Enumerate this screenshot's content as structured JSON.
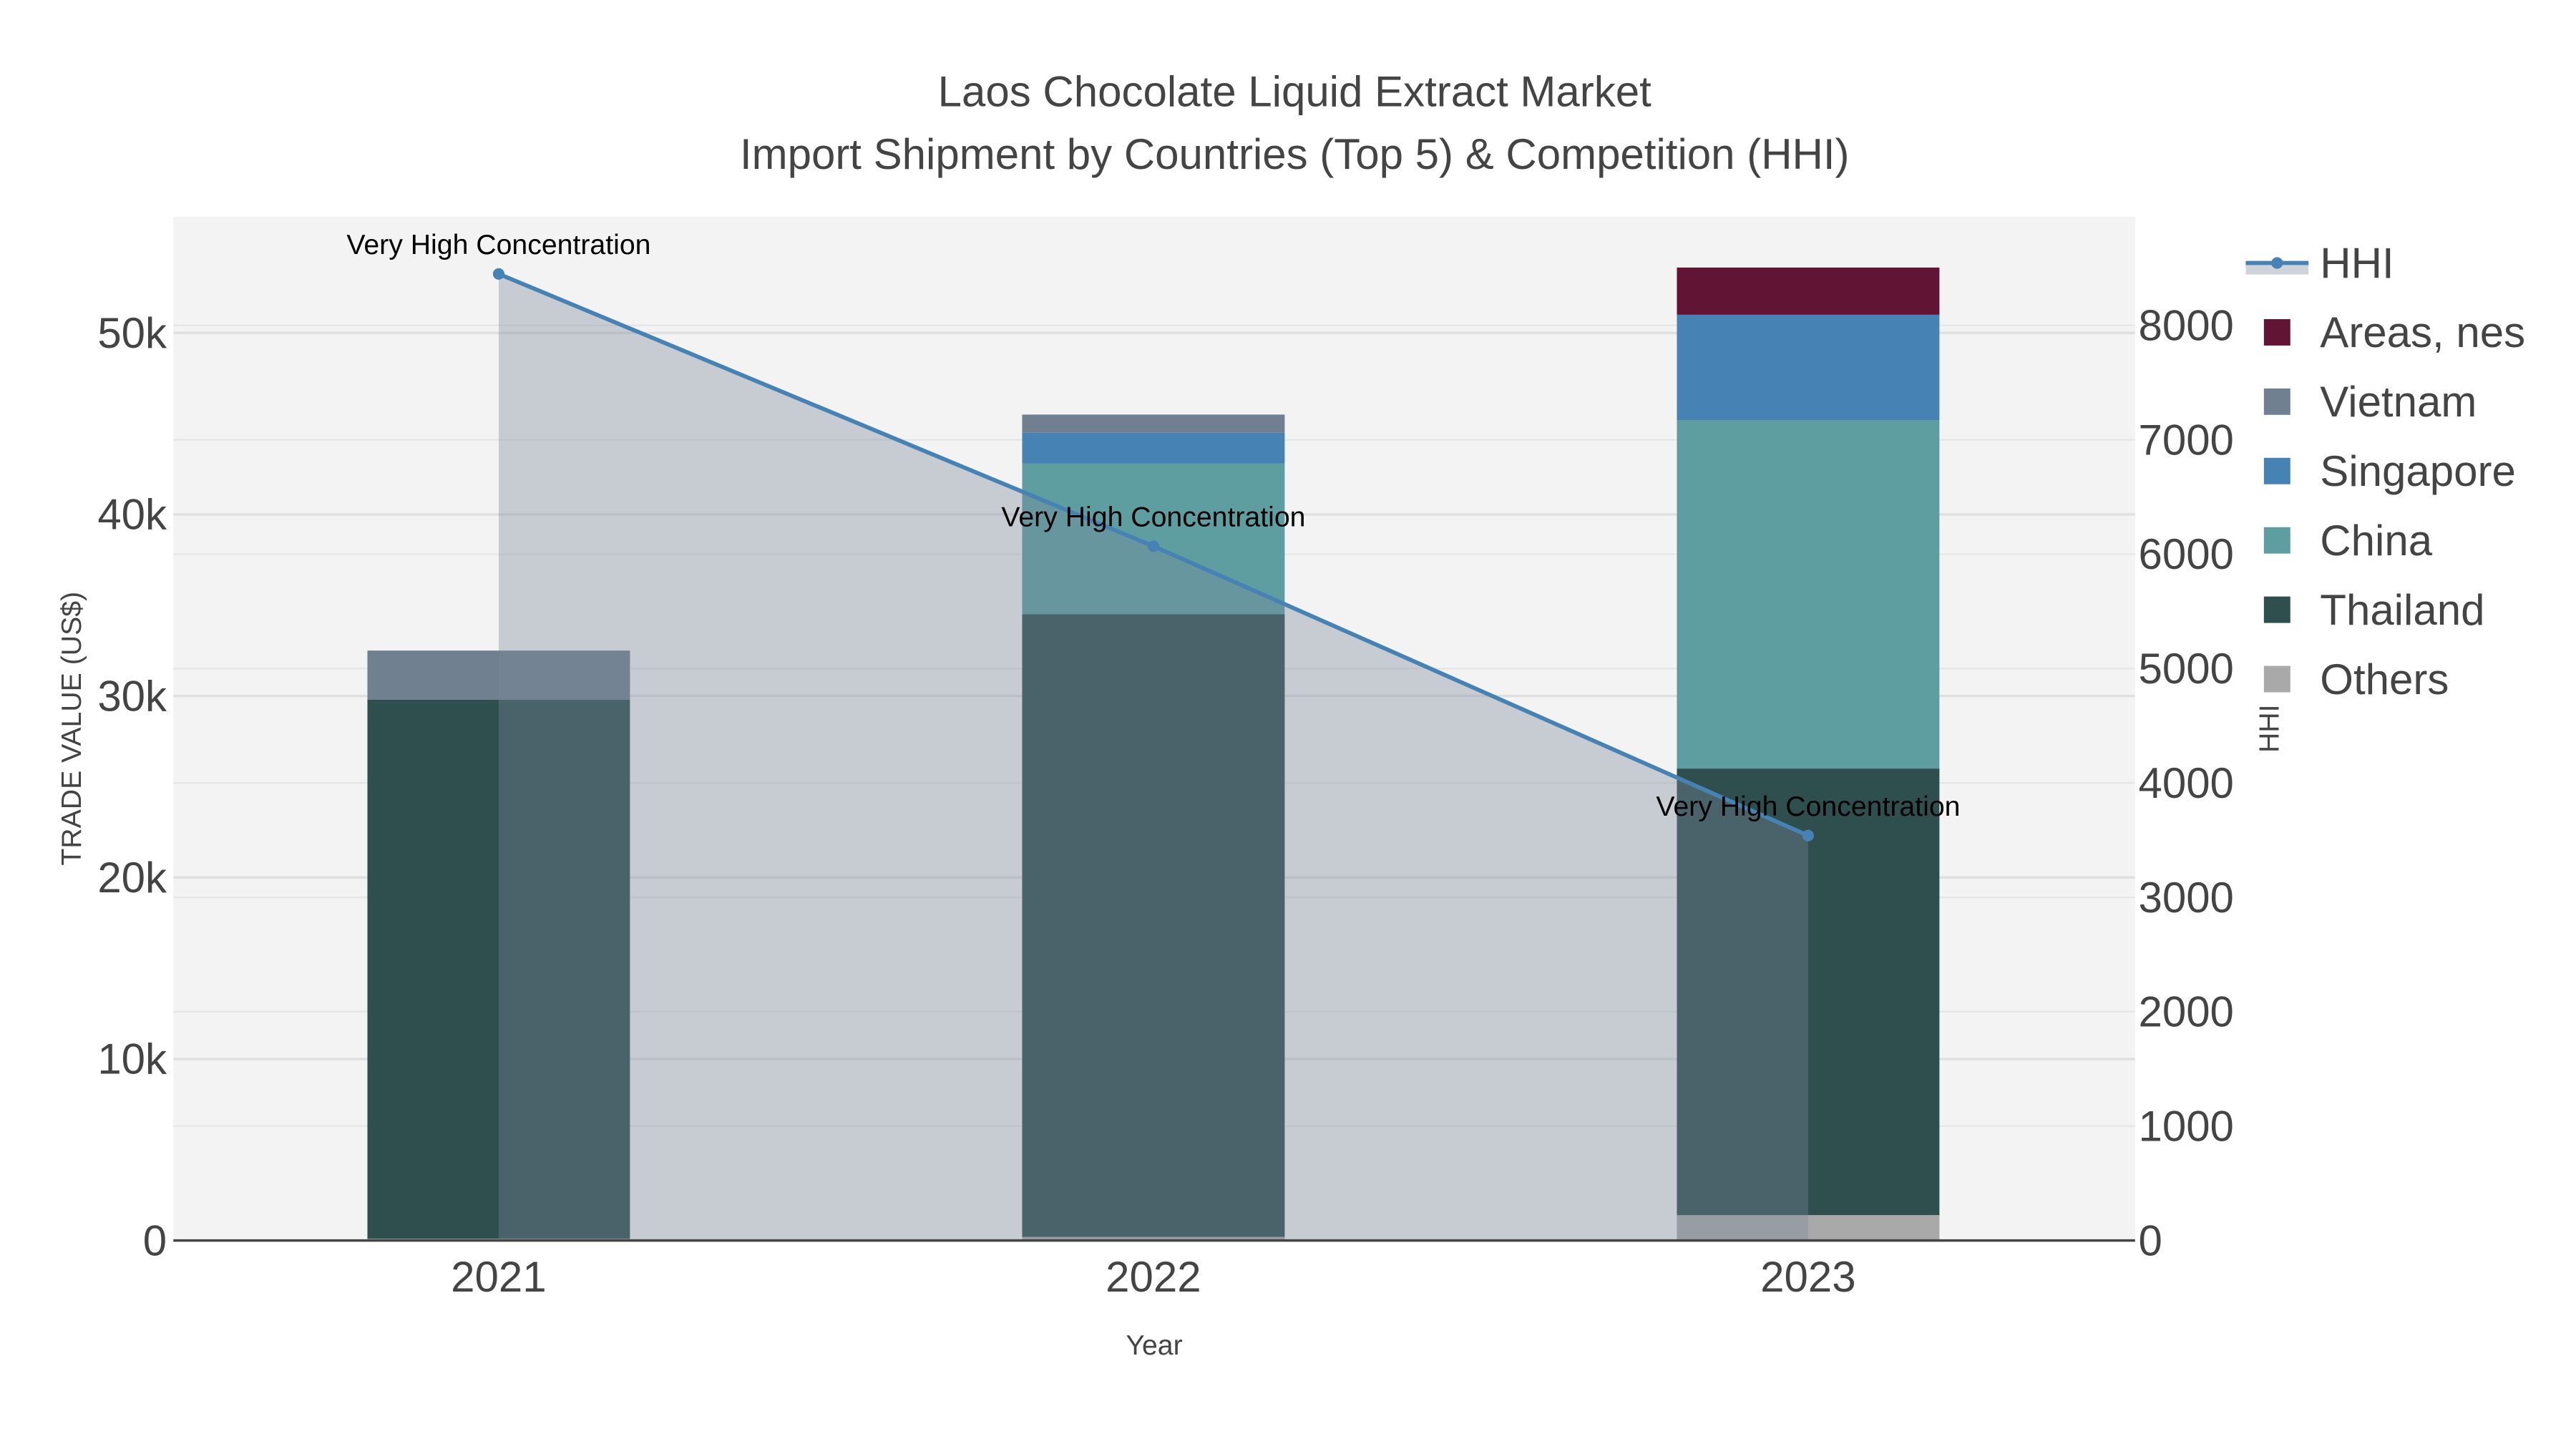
{
  "chart_data": {
    "type": "bar",
    "title": "Laos Chocolate Liquid Extract Market",
    "subtitle": "Import Shipment by Countries (Top 5) & Competition (HHI)",
    "xlabel": "Year",
    "ylabel": "TRADE VALUE (US$)",
    "y2label": "HHI",
    "categories": [
      "2021",
      "2022",
      "2023"
    ],
    "ylim": [
      0,
      56400
    ],
    "y2lim": [
      0,
      8950
    ],
    "yticks": [
      0,
      10000,
      20000,
      30000,
      40000,
      50000
    ],
    "ytick_labels": [
      "0",
      "10k",
      "20k",
      "30k",
      "40k",
      "50k"
    ],
    "y2ticks": [
      0,
      1000,
      2000,
      3000,
      4000,
      5000,
      6000,
      7000,
      8000
    ],
    "y2tick_labels": [
      "0",
      "1000",
      "2000",
      "3000",
      "4000",
      "5000",
      "6000",
      "7000",
      "8000"
    ],
    "stacked": true,
    "series": [
      {
        "name": "Others",
        "color": "#a9a9a9",
        "values": [
          100,
          200,
          1400
        ]
      },
      {
        "name": "Thailand",
        "color": "#2f4f4f",
        "values": [
          29700,
          34300,
          24600
        ]
      },
      {
        "name": "China",
        "color": "#5f9ea0",
        "values": [
          0,
          8300,
          19200
        ]
      },
      {
        "name": "Singapore",
        "color": "#4682b4",
        "values": [
          0,
          1700,
          5800
        ]
      },
      {
        "name": "Vietnam",
        "color": "#708090",
        "values": [
          2700,
          1000,
          0
        ]
      },
      {
        "name": "Areas, nes",
        "color": "#621434",
        "values": [
          0,
          0,
          2600
        ]
      }
    ],
    "hhi": {
      "name": "HHI",
      "color": "#4682b4",
      "values": [
        8450,
        6070,
        3540
      ],
      "annotations": [
        "Very High Concentration",
        "Very High Concentration",
        "Very High Concentration"
      ]
    },
    "legend_order": [
      "HHI",
      "Areas, nes",
      "Vietnam",
      "Singapore",
      "China",
      "Thailand",
      "Others"
    ],
    "legend_position": "right",
    "grid": true
  }
}
